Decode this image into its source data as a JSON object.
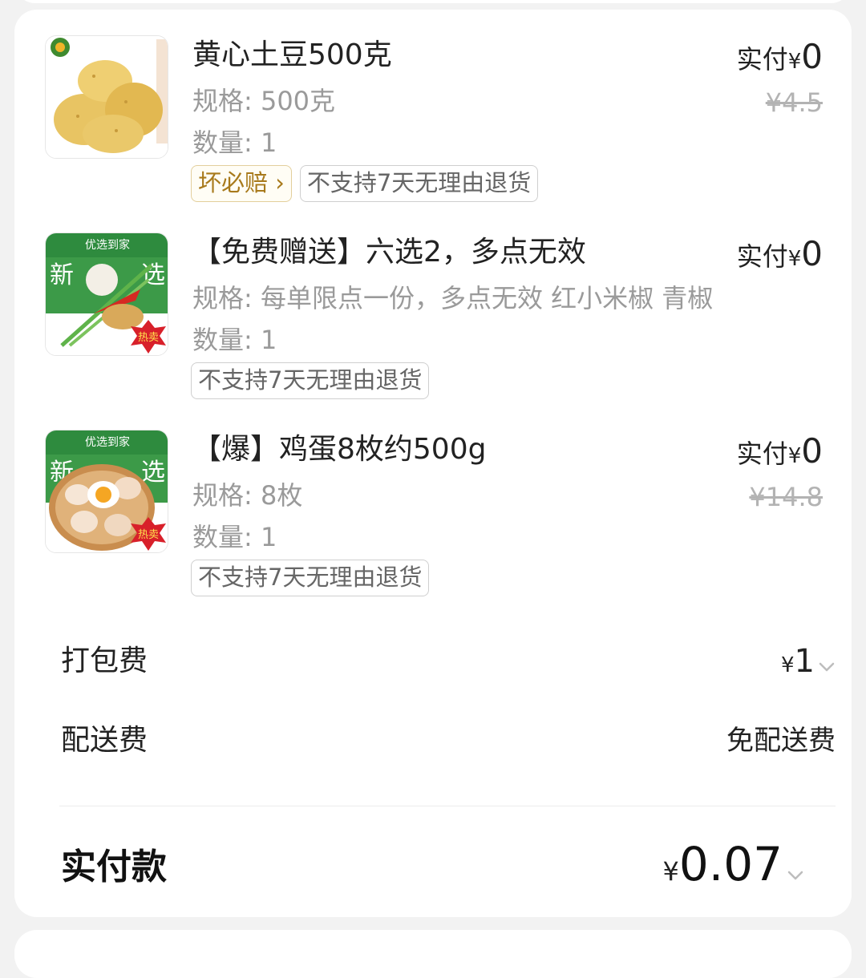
{
  "items": [
    {
      "name": "黄心土豆500克",
      "spec": "规格: 500克",
      "qty": "数量: 1",
      "pay_label": "实付",
      "currency": "¥",
      "pay_value": "0",
      "original_price": "¥4.5",
      "tags": [
        "坏必赔 ›",
        "不支持7天无理由退货"
      ]
    },
    {
      "name": "【免费赠送】六选2，多点无效",
      "spec": "规格: 每单限点一份，多点无效 红小米椒 青椒",
      "qty": "数量: 1",
      "pay_label": "实付",
      "currency": "¥",
      "pay_value": "0",
      "tags": [
        "不支持7天无理由退货"
      ],
      "image_text": [
        "优选到家",
        "新",
        "选",
        "热卖"
      ]
    },
    {
      "name": "【爆】鸡蛋8枚约500g",
      "spec": "规格: 8枚",
      "qty": "数量: 1",
      "pay_label": "实付",
      "currency": "¥",
      "pay_value": "0",
      "original_price": "¥14.8",
      "tags": [
        "不支持7天无理由退货"
      ],
      "image_text": [
        "优选到家",
        "新",
        "选",
        "热卖"
      ]
    }
  ],
  "packaging": {
    "label": "打包费",
    "currency": "¥",
    "value": "1"
  },
  "delivery": {
    "label": "配送费",
    "value": "免配送费"
  },
  "total": {
    "label": "实付款",
    "currency": "¥",
    "value": "0.07"
  },
  "colors": {
    "tag_gold": "#a87a1c",
    "brand_green": "#2e8b3e",
    "hot_red": "#d8202a"
  },
  "icons": {
    "expand": "chevron-down-icon"
  }
}
